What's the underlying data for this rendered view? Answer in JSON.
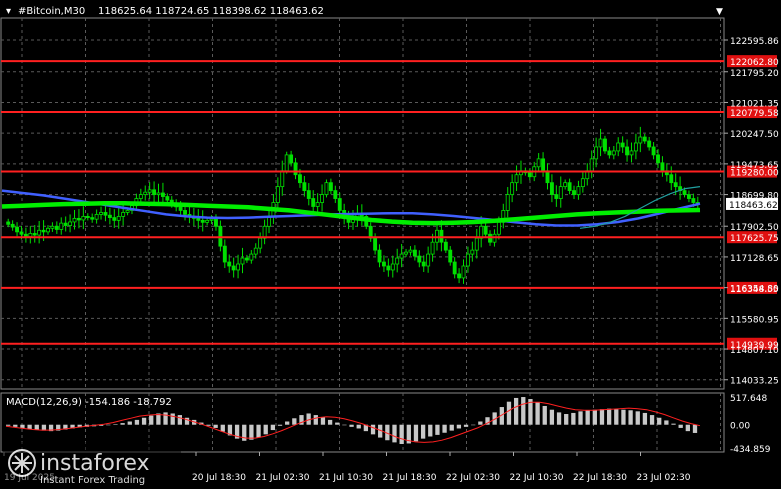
{
  "header": {
    "symbol": "#Bitcoin,M30",
    "ohlc": "118625.64 118724.65 118398.62 118463.62"
  },
  "indicator": {
    "label": "MACD(12,26,9) -154.186 -18.792",
    "ticks": [
      "517.648",
      "0.00",
      "-434.859"
    ],
    "tick_values": [
      517.648,
      0,
      -434.859
    ]
  },
  "watermark": {
    "brand": "instaforex",
    "tagline": "Instant Forex Trading"
  },
  "colors": {
    "background": "#000000",
    "grid": "#5a5a5a",
    "bull": "#00e000",
    "bear": "#00e000",
    "level_line": "#ff2020",
    "level_label_bg": "#e01010",
    "ma_fast": "#00ee00",
    "ma_slow": "#4060ff",
    "ma_teal": "#20a0a0",
    "macd_hist": "#c8c8c8",
    "macd_signal": "#ff2020",
    "current_price_bg": "#ffffff"
  },
  "chart_data": {
    "type": "candlestick",
    "ylim": [
      113800,
      123150
    ],
    "y_ticks": [
      {
        "label": "122595.86",
        "value": 122595.86
      },
      {
        "label": "121795.20",
        "value": 121795.2
      },
      {
        "label": "121021.35",
        "value": 121021.35
      },
      {
        "label": "120247.50",
        "value": 120247.5
      },
      {
        "label": "119473.65",
        "value": 119473.65
      },
      {
        "label": "118699.80",
        "value": 118699.8
      },
      {
        "label": "117902.50",
        "value": 117902.5
      },
      {
        "label": "117128.65",
        "value": 117128.65
      },
      {
        "label": "116354.80",
        "value": 116354.8
      },
      {
        "label": "115580.95",
        "value": 115580.95
      },
      {
        "label": "114807.10",
        "value": 114807.1
      },
      {
        "label": "114033.25",
        "value": 114033.25
      }
    ],
    "levels": [
      {
        "label": "122062.80",
        "value": 122062.8
      },
      {
        "label": "120779.58",
        "value": 120779.58
      },
      {
        "label": "119280.00",
        "value": 119280.0
      },
      {
        "label": "117625.75",
        "value": 117625.75
      },
      {
        "label": "116348.55",
        "value": 116348.55
      },
      {
        "label": "114939.99",
        "value": 114939.99
      }
    ],
    "current_price": {
      "label": "118463.62",
      "value": 118463.62
    },
    "x_labels": [
      "19 Jul 2025",
      "20 Jul 18:30",
      "21 Jul 02:30",
      "21 Jul 10:30",
      "21 Jul 18:30",
      "22 Jul 02:30",
      "22 Jul 10:30",
      "22 Jul 18:30",
      "23 Jul 02:30"
    ],
    "closes": [
      117950,
      117880,
      117760,
      117700,
      117640,
      117720,
      117680,
      117800,
      117760,
      117850,
      117900,
      117820,
      117980,
      117920,
      118010,
      118100,
      118060,
      118150,
      118120,
      118080,
      118200,
      118250,
      118180,
      118120,
      118050,
      118150,
      118250,
      118300,
      118420,
      118600,
      118700,
      118760,
      118820,
      118700,
      118740,
      118650,
      118560,
      118460,
      118390,
      118300,
      118200,
      118150,
      118100,
      118050,
      118000,
      118050,
      118080,
      117900,
      117400,
      117000,
      116900,
      116800,
      116950,
      117100,
      117050,
      117200,
      117350,
      117600,
      117900,
      118150,
      118500,
      118900,
      119300,
      119700,
      119500,
      119200,
      119000,
      118800,
      118600,
      118400,
      118500,
      118700,
      119000,
      118800,
      118600,
      118300,
      118100,
      118000,
      118100,
      118200,
      118150,
      117900,
      117600,
      117300,
      117000,
      116900,
      116800,
      116950,
      117100,
      117200,
      117250,
      117300,
      117150,
      117000,
      116900,
      117200,
      117500,
      117800,
      117500,
      117300,
      117000,
      116700,
      116600,
      116900,
      117200,
      117300,
      117600,
      117900,
      117700,
      117500,
      117700,
      118000,
      118300,
      118700,
      119000,
      119200,
      119300,
      119250,
      119150,
      119400,
      119600,
      119300,
      119000,
      118700,
      118600,
      118900,
      119000,
      118800,
      118700,
      118900,
      119100,
      119300,
      119600,
      119900,
      120100,
      119800,
      119700,
      119800,
      120000,
      119900,
      119700,
      119800,
      120000,
      120150,
      120050,
      119900,
      119700,
      119500,
      119300,
      119200,
      119000,
      118900,
      118800,
      118700,
      118600,
      118500,
      118463.62
    ],
    "ma_fast": [
      118400,
      118420,
      118440,
      118460,
      118470,
      118480,
      118480,
      118470,
      118460,
      118440,
      118420,
      118400,
      118380,
      118340,
      118300,
      118240,
      118180,
      118120,
      118060,
      118020,
      117990,
      117980,
      117990,
      118010,
      118040,
      118080,
      118120,
      118160,
      118200,
      118230,
      118250,
      118270,
      118290,
      118300,
      118310
    ],
    "ma_slow": [
      118800,
      118740,
      118680,
      118600,
      118520,
      118440,
      118360,
      118280,
      118200,
      118150,
      118120,
      118110,
      118120,
      118140,
      118160,
      118180,
      118200,
      118210,
      118220,
      118230,
      118230,
      118200,
      118160,
      118110,
      118060,
      118000,
      117950,
      117920,
      117920,
      117950,
      118010,
      118100,
      118220,
      118350,
      118470
    ],
    "ma_teal": [
      117850,
      117900,
      118000,
      118150,
      118350,
      118550,
      118720,
      118850,
      118900
    ],
    "macd_hist": [
      -20,
      -40,
      -60,
      -80,
      -90,
      -110,
      -120,
      -110,
      -90,
      -70,
      -50,
      -40,
      -30,
      -20,
      -10,
      10,
      30,
      60,
      90,
      130,
      170,
      210,
      230,
      210,
      180,
      130,
      90,
      40,
      -20,
      -60,
      -130,
      -200,
      -260,
      -300,
      -280,
      -240,
      -180,
      -100,
      -20,
      60,
      120,
      180,
      210,
      180,
      140,
      90,
      40,
      -10,
      -40,
      -70,
      -120,
      -180,
      -240,
      -290,
      -330,
      -360,
      -350,
      -310,
      -260,
      -220,
      -190,
      -150,
      -110,
      -70,
      -40,
      0,
      60,
      140,
      230,
      330,
      430,
      500,
      517,
      480,
      420,
      350,
      280,
      230,
      200,
      220,
      250,
      270,
      280,
      290,
      300,
      290,
      280,
      270,
      250,
      220,
      180,
      130,
      80,
      20,
      -60,
      -120,
      -154
    ],
    "macd_signal": [
      -30,
      -50,
      -70,
      -90,
      -100,
      -100,
      -90,
      -70,
      -50,
      -30,
      -10,
      10,
      40,
      80,
      120,
      160,
      180,
      190,
      180,
      150,
      110,
      60,
      10,
      -50,
      -110,
      -170,
      -220,
      -250,
      -250,
      -220,
      -170,
      -110,
      -40,
      30,
      90,
      130,
      150,
      140,
      110,
      70,
      20,
      -40,
      -100,
      -170,
      -240,
      -290,
      -320,
      -330,
      -320,
      -290,
      -240,
      -180,
      -120,
      -60,
      20,
      110,
      210,
      310,
      380,
      420,
      420,
      390,
      350,
      310,
      280,
      270,
      270,
      280,
      290,
      300,
      310,
      300,
      280,
      240,
      190,
      130,
      70,
      20,
      -19
    ]
  }
}
